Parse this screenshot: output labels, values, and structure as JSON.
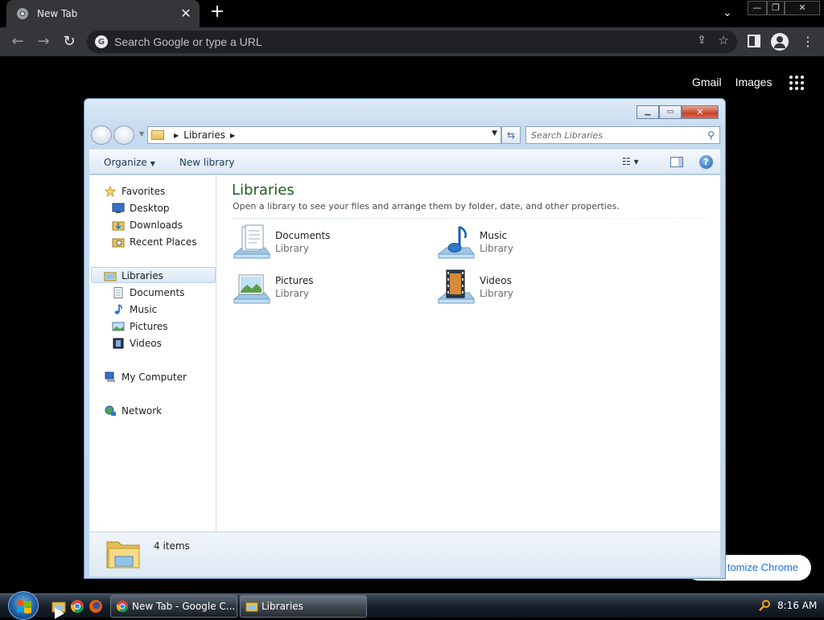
{
  "chrome": {
    "tab_title": "New Tab",
    "new_tab_symbol": "+",
    "omnibox_placeholder": "Search Google or type a URL",
    "ntp_links": [
      "Gmail",
      "Images"
    ],
    "customize_label": "Customize Chrome",
    "customize_visible": "tomize Chrome"
  },
  "explorer": {
    "address_crumb": "Libraries",
    "search_placeholder": "Search Libraries",
    "toolbar": {
      "organize": "Organize",
      "new_library": "New library"
    },
    "nav": {
      "favorites": "Favorites",
      "favorites_items": [
        "Desktop",
        "Downloads",
        "Recent Places"
      ],
      "libraries": "Libraries",
      "libraries_items": [
        "Documents",
        "Music",
        "Pictures",
        "Videos"
      ],
      "my_computer": "My Computer",
      "network": "Network"
    },
    "content": {
      "title": "Libraries",
      "subtitle": "Open a library to see your files and arrange them by folder, date, and other properties.",
      "libraries": [
        {
          "name": "Documents",
          "type": "Library",
          "icon": "documents-library-icon"
        },
        {
          "name": "Music",
          "type": "Library",
          "icon": "music-library-icon"
        },
        {
          "name": "Pictures",
          "type": "Library",
          "icon": "pictures-library-icon"
        },
        {
          "name": "Videos",
          "type": "Library",
          "icon": "videos-library-icon"
        }
      ]
    },
    "status": "4 items"
  },
  "taskbar": {
    "tasks": [
      "New Tab - Google C...",
      "Libraries"
    ],
    "clock": "8:16 AM"
  },
  "colors": {
    "chrome_toolbar": "#35363a",
    "explorer_title_green": "#1e5e1e",
    "explorer_frame": "#c6dbef"
  }
}
